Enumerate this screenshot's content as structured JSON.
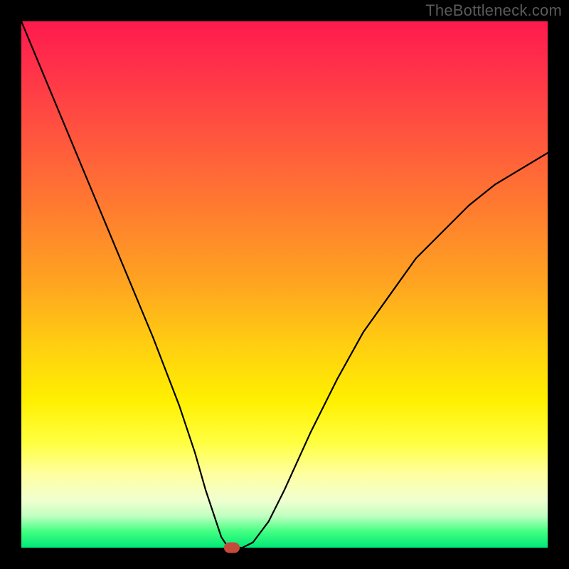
{
  "watermark": "TheBottleneck.com",
  "chart_data": {
    "type": "line",
    "title": "",
    "xlabel": "",
    "ylabel": "",
    "xlim": [
      0,
      100
    ],
    "ylim": [
      0,
      100
    ],
    "grid": false,
    "legend": false,
    "series": [
      {
        "name": "bottleneck-curve",
        "x": [
          0,
          5,
          10,
          15,
          20,
          25,
          30,
          33,
          35,
          37,
          38,
          39,
          40,
          42,
          44,
          47,
          50,
          55,
          60,
          65,
          70,
          75,
          80,
          85,
          90,
          95,
          100
        ],
        "values": [
          100,
          88,
          76,
          64,
          52,
          40,
          27,
          18,
          11,
          5,
          2,
          0.5,
          0,
          0,
          1,
          5,
          11,
          22,
          32,
          41,
          48,
          55,
          60,
          65,
          69,
          72,
          75
        ]
      }
    ],
    "marker": {
      "x": 40,
      "y": 0,
      "color": "#c54a3a"
    },
    "background_gradient": {
      "top": "#ff1a4d",
      "mid": "#fff000",
      "bottom": "#00e878"
    }
  }
}
